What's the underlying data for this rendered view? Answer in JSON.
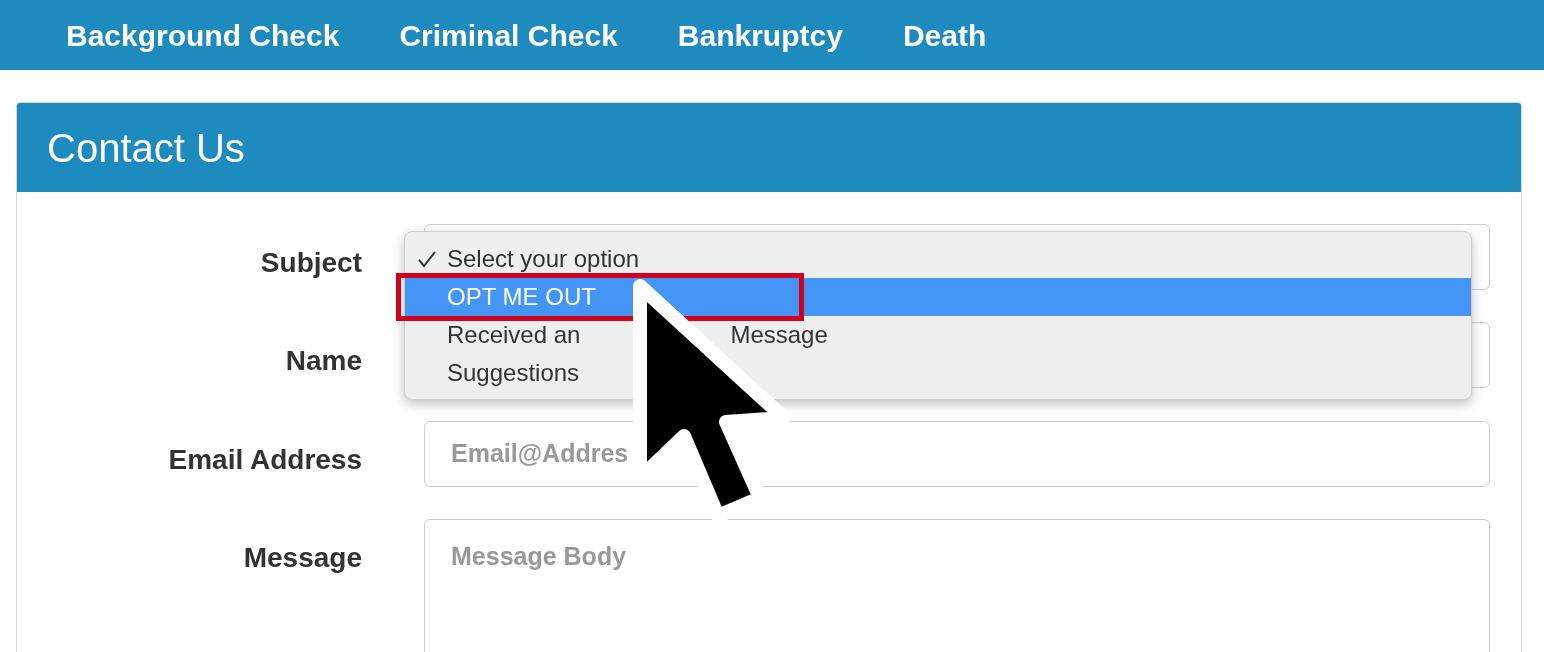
{
  "nav": {
    "items": [
      "Background Check",
      "Criminal Check",
      "Bankruptcy",
      "Death"
    ]
  },
  "panel": {
    "title": "Contact Us",
    "fields": [
      {
        "label": "Subject",
        "kind": "select"
      },
      {
        "label": "Name",
        "kind": "input"
      },
      {
        "label": "Email Address",
        "kind": "input",
        "placeholder": "Email@Addres"
      },
      {
        "label": "Message",
        "kind": "textarea",
        "placeholder": "Message Body"
      }
    ]
  },
  "dropdown": {
    "options": [
      {
        "label": "Select your option",
        "checked": true,
        "selected": false
      },
      {
        "label": "OPT ME OUT",
        "checked": false,
        "selected": true
      },
      {
        "label": "Received an",
        "label_tail": "Message",
        "checked": false,
        "selected": false
      },
      {
        "label": "Suggestions",
        "checked": false,
        "selected": false
      }
    ]
  }
}
